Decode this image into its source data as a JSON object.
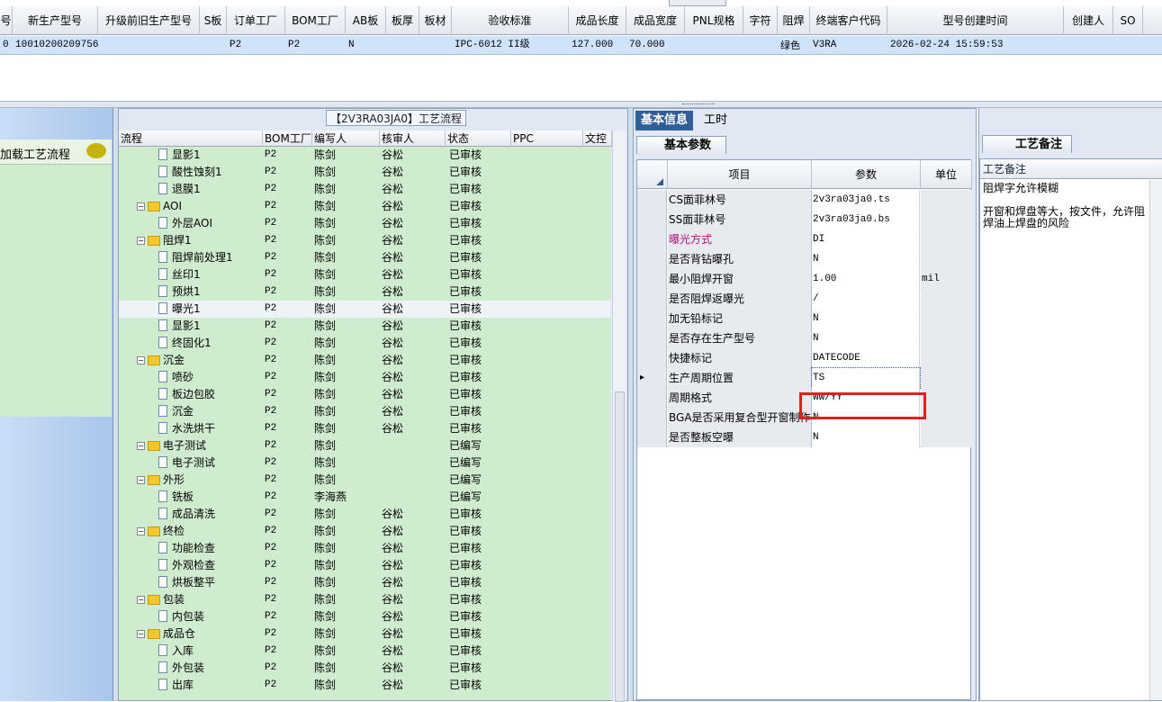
{
  "top_grid": {
    "columns": [
      "号",
      "新生产型号",
      "升级前旧生产型号",
      "S板",
      "订单工厂",
      "BOM工厂",
      "AB板",
      "板厚",
      "板材",
      "验收标准",
      "成品长度",
      "成品宽度",
      "PNL规格",
      "字符",
      "阻焊",
      "终端客户代码",
      "型号创建时间",
      "创建人",
      "SO"
    ],
    "row": [
      "0",
      "10010200209756",
      "",
      "",
      "P2",
      "P2",
      "N",
      "",
      "",
      "IPC-6012 II级",
      "127.000",
      "70.000",
      "",
      "",
      "绿色",
      "V3RA",
      "2026-02-24 15:59:53",
      "",
      ""
    ]
  },
  "left_panel": {
    "title": "加载工艺流程"
  },
  "tree": {
    "title": "【2V3RA03JA0】工艺流程",
    "columns": [
      "流程",
      "BOM工厂",
      "编写人",
      "核审人",
      "状态",
      "PPC",
      "文控"
    ],
    "rows": [
      {
        "level": 1,
        "icon": "doc",
        "name": "显影1",
        "bom": "P2",
        "writer": "陈剑",
        "reviewer": "谷松",
        "status": "已审核"
      },
      {
        "level": 1,
        "icon": "doc",
        "name": "酸性蚀刻1",
        "bom": "P2",
        "writer": "陈剑",
        "reviewer": "谷松",
        "status": "已审核"
      },
      {
        "level": 1,
        "icon": "doc",
        "name": "退膜1",
        "bom": "P2",
        "writer": "陈剑",
        "reviewer": "谷松",
        "status": "已审核"
      },
      {
        "level": 0,
        "icon": "folder",
        "name": "AOI",
        "bom": "P2",
        "writer": "陈剑",
        "reviewer": "谷松",
        "status": "已审核"
      },
      {
        "level": 1,
        "icon": "doc",
        "name": "外层AOI",
        "bom": "P2",
        "writer": "陈剑",
        "reviewer": "谷松",
        "status": "已审核"
      },
      {
        "level": 0,
        "icon": "folder",
        "name": "阻焊1",
        "bom": "P2",
        "writer": "陈剑",
        "reviewer": "谷松",
        "status": "已审核"
      },
      {
        "level": 1,
        "icon": "doc",
        "name": "阻焊前处理1",
        "bom": "P2",
        "writer": "陈剑",
        "reviewer": "谷松",
        "status": "已审核"
      },
      {
        "level": 1,
        "icon": "doc",
        "name": "丝印1",
        "bom": "P2",
        "writer": "陈剑",
        "reviewer": "谷松",
        "status": "已审核"
      },
      {
        "level": 1,
        "icon": "doc",
        "name": "预烘1",
        "bom": "P2",
        "writer": "陈剑",
        "reviewer": "谷松",
        "status": "已审核"
      },
      {
        "level": 1,
        "icon": "doc",
        "name": "曝光1",
        "bom": "P2",
        "writer": "陈剑",
        "reviewer": "谷松",
        "status": "已审核",
        "selected": true
      },
      {
        "level": 1,
        "icon": "doc",
        "name": "显影1",
        "bom": "P2",
        "writer": "陈剑",
        "reviewer": "谷松",
        "status": "已审核"
      },
      {
        "level": 1,
        "icon": "doc",
        "name": "终固化1",
        "bom": "P2",
        "writer": "陈剑",
        "reviewer": "谷松",
        "status": "已审核"
      },
      {
        "level": 0,
        "icon": "folder",
        "name": "沉金",
        "bom": "P2",
        "writer": "陈剑",
        "reviewer": "谷松",
        "status": "已审核"
      },
      {
        "level": 1,
        "icon": "doc",
        "name": "喷砂",
        "bom": "P2",
        "writer": "陈剑",
        "reviewer": "谷松",
        "status": "已审核"
      },
      {
        "level": 1,
        "icon": "doc",
        "name": "板边包胶",
        "bom": "P2",
        "writer": "陈剑",
        "reviewer": "谷松",
        "status": "已审核"
      },
      {
        "level": 1,
        "icon": "doc",
        "name": "沉金",
        "bom": "P2",
        "writer": "陈剑",
        "reviewer": "谷松",
        "status": "已审核"
      },
      {
        "level": 1,
        "icon": "doc",
        "name": "水洗烘干",
        "bom": "P2",
        "writer": "陈剑",
        "reviewer": "谷松",
        "status": "已审核"
      },
      {
        "level": 0,
        "icon": "folder",
        "name": "电子测试",
        "bom": "P2",
        "writer": "陈剑",
        "reviewer": "",
        "status": "已编写"
      },
      {
        "level": 1,
        "icon": "doc",
        "name": "电子测试",
        "bom": "P2",
        "writer": "陈剑",
        "reviewer": "",
        "status": "已编写"
      },
      {
        "level": 0,
        "icon": "folder",
        "name": "外形",
        "bom": "P2",
        "writer": "陈剑",
        "reviewer": "",
        "status": "已编写"
      },
      {
        "level": 1,
        "icon": "doc",
        "name": "铣板",
        "bom": "P2",
        "writer": "李海燕",
        "reviewer": "",
        "status": "已编写"
      },
      {
        "level": 1,
        "icon": "doc",
        "name": "成品清洗",
        "bom": "P2",
        "writer": "陈剑",
        "reviewer": "谷松",
        "status": "已审核"
      },
      {
        "level": 0,
        "icon": "folder",
        "name": "终检",
        "bom": "P2",
        "writer": "陈剑",
        "reviewer": "谷松",
        "status": "已审核"
      },
      {
        "level": 1,
        "icon": "doc",
        "name": "功能检查",
        "bom": "P2",
        "writer": "陈剑",
        "reviewer": "谷松",
        "status": "已审核"
      },
      {
        "level": 1,
        "icon": "doc",
        "name": "外观检查",
        "bom": "P2",
        "writer": "陈剑",
        "reviewer": "谷松",
        "status": "已审核"
      },
      {
        "level": 1,
        "icon": "doc",
        "name": "烘板整平",
        "bom": "P2",
        "writer": "陈剑",
        "reviewer": "谷松",
        "status": "已审核"
      },
      {
        "level": 0,
        "icon": "folder",
        "name": "包装",
        "bom": "P2",
        "writer": "陈剑",
        "reviewer": "谷松",
        "status": "已审核"
      },
      {
        "level": 1,
        "icon": "doc",
        "name": "内包装",
        "bom": "P2",
        "writer": "陈剑",
        "reviewer": "谷松",
        "status": "已审核"
      },
      {
        "level": 0,
        "icon": "folder",
        "name": "成品仓",
        "bom": "P2",
        "writer": "陈剑",
        "reviewer": "谷松",
        "status": "已审核"
      },
      {
        "level": 1,
        "icon": "doc",
        "name": "入库",
        "bom": "P2",
        "writer": "陈剑",
        "reviewer": "谷松",
        "status": "已审核"
      },
      {
        "level": 1,
        "icon": "doc",
        "name": "外包装",
        "bom": "P2",
        "writer": "陈剑",
        "reviewer": "谷松",
        "status": "已审核"
      },
      {
        "level": 1,
        "icon": "doc",
        "name": "出库",
        "bom": "P2",
        "writer": "陈剑",
        "reviewer": "谷松",
        "status": "已审核"
      }
    ]
  },
  "info": {
    "tabs": [
      "基本信息",
      "工时"
    ],
    "subtab": "基本参数",
    "columns": [
      "项目",
      "参数",
      "单位"
    ],
    "rows": [
      {
        "k": "CS面菲林号",
        "v": "2v3ra03ja0.ts",
        "u": ""
      },
      {
        "k": "SS面菲林号",
        "v": "2v3ra03ja0.bs",
        "u": ""
      },
      {
        "k": "曝光方式",
        "v": "DI",
        "u": "",
        "color": "#b0127a"
      },
      {
        "k": "是否背钻曝孔",
        "v": "N",
        "u": ""
      },
      {
        "k": "最小阻焊开窗",
        "v": "1.00",
        "u": "mil"
      },
      {
        "k": "是否阻焊返曝光",
        "v": "/",
        "u": ""
      },
      {
        "k": "加无铅标记",
        "v": "N",
        "u": ""
      },
      {
        "k": "是否存在生产型号",
        "v": "N",
        "u": ""
      },
      {
        "k": "快捷标记",
        "v": "DATECODE",
        "u": ""
      },
      {
        "k": "生产周期位置",
        "v": "TS",
        "u": "",
        "current": true
      },
      {
        "k": "周期格式",
        "v": "WW/YY",
        "u": ""
      },
      {
        "k": "BGA是否采用复合型开窗制作",
        "v": "N",
        "u": ""
      },
      {
        "k": "是否整板空曝",
        "v": "N",
        "u": ""
      }
    ]
  },
  "remark": {
    "subtab": "工艺备注",
    "header": "工艺备注",
    "text": "阻焊字允许模糊\n\n开窗和焊盘等大，按文件，允许阻焊油上焊盘的风险"
  },
  "colors": {
    "accent": "#2f5f96",
    "tree_bg": "#cfeccf",
    "selection": "#cfe4fb",
    "highlight": "#e02020"
  }
}
